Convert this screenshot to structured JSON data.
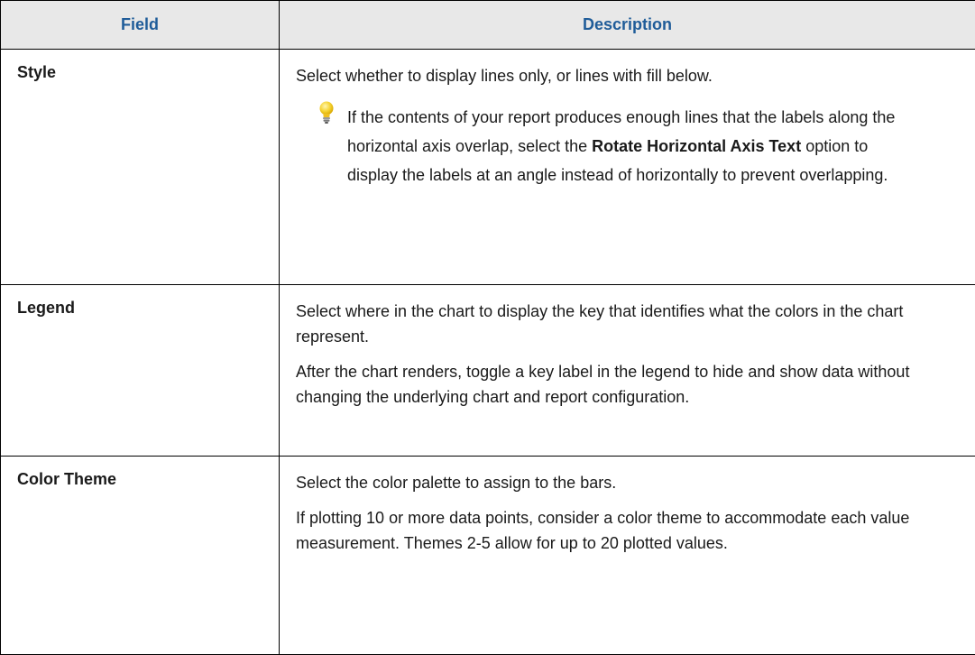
{
  "table": {
    "headers": {
      "field": "Field",
      "description": "Description"
    },
    "rows": [
      {
        "field": "Style",
        "paragraphs": [
          "Select whether to display lines only, or lines with fill below."
        ],
        "tip": {
          "icon": "lightbulb-icon",
          "pre": "If the contents of your report produces enough lines that the labels along the horizontal axis overlap, select the ",
          "bold": "Rotate Horizontal Axis Text",
          "post": " option to display the labels at an angle instead of horizontally to prevent overlapping."
        }
      },
      {
        "field": "Legend",
        "paragraphs": [
          "Select where in the chart to display the key that identifies what the colors in the chart represent.",
          "After the chart renders, toggle a key label in the legend to hide and show data without changing the underlying chart and report configuration."
        ]
      },
      {
        "field": "Color Theme",
        "paragraphs": [
          "Select the color palette to assign to the bars.",
          "If plotting 10 or more data points, consider a color theme to accommodate each value measurement. Themes 2-5 allow for up to 20 plotted values."
        ]
      }
    ]
  },
  "colors": {
    "header_bg": "#e8e8e8",
    "header_text": "#1f5c99",
    "border": "#000000",
    "bulb": "#f5d230"
  }
}
